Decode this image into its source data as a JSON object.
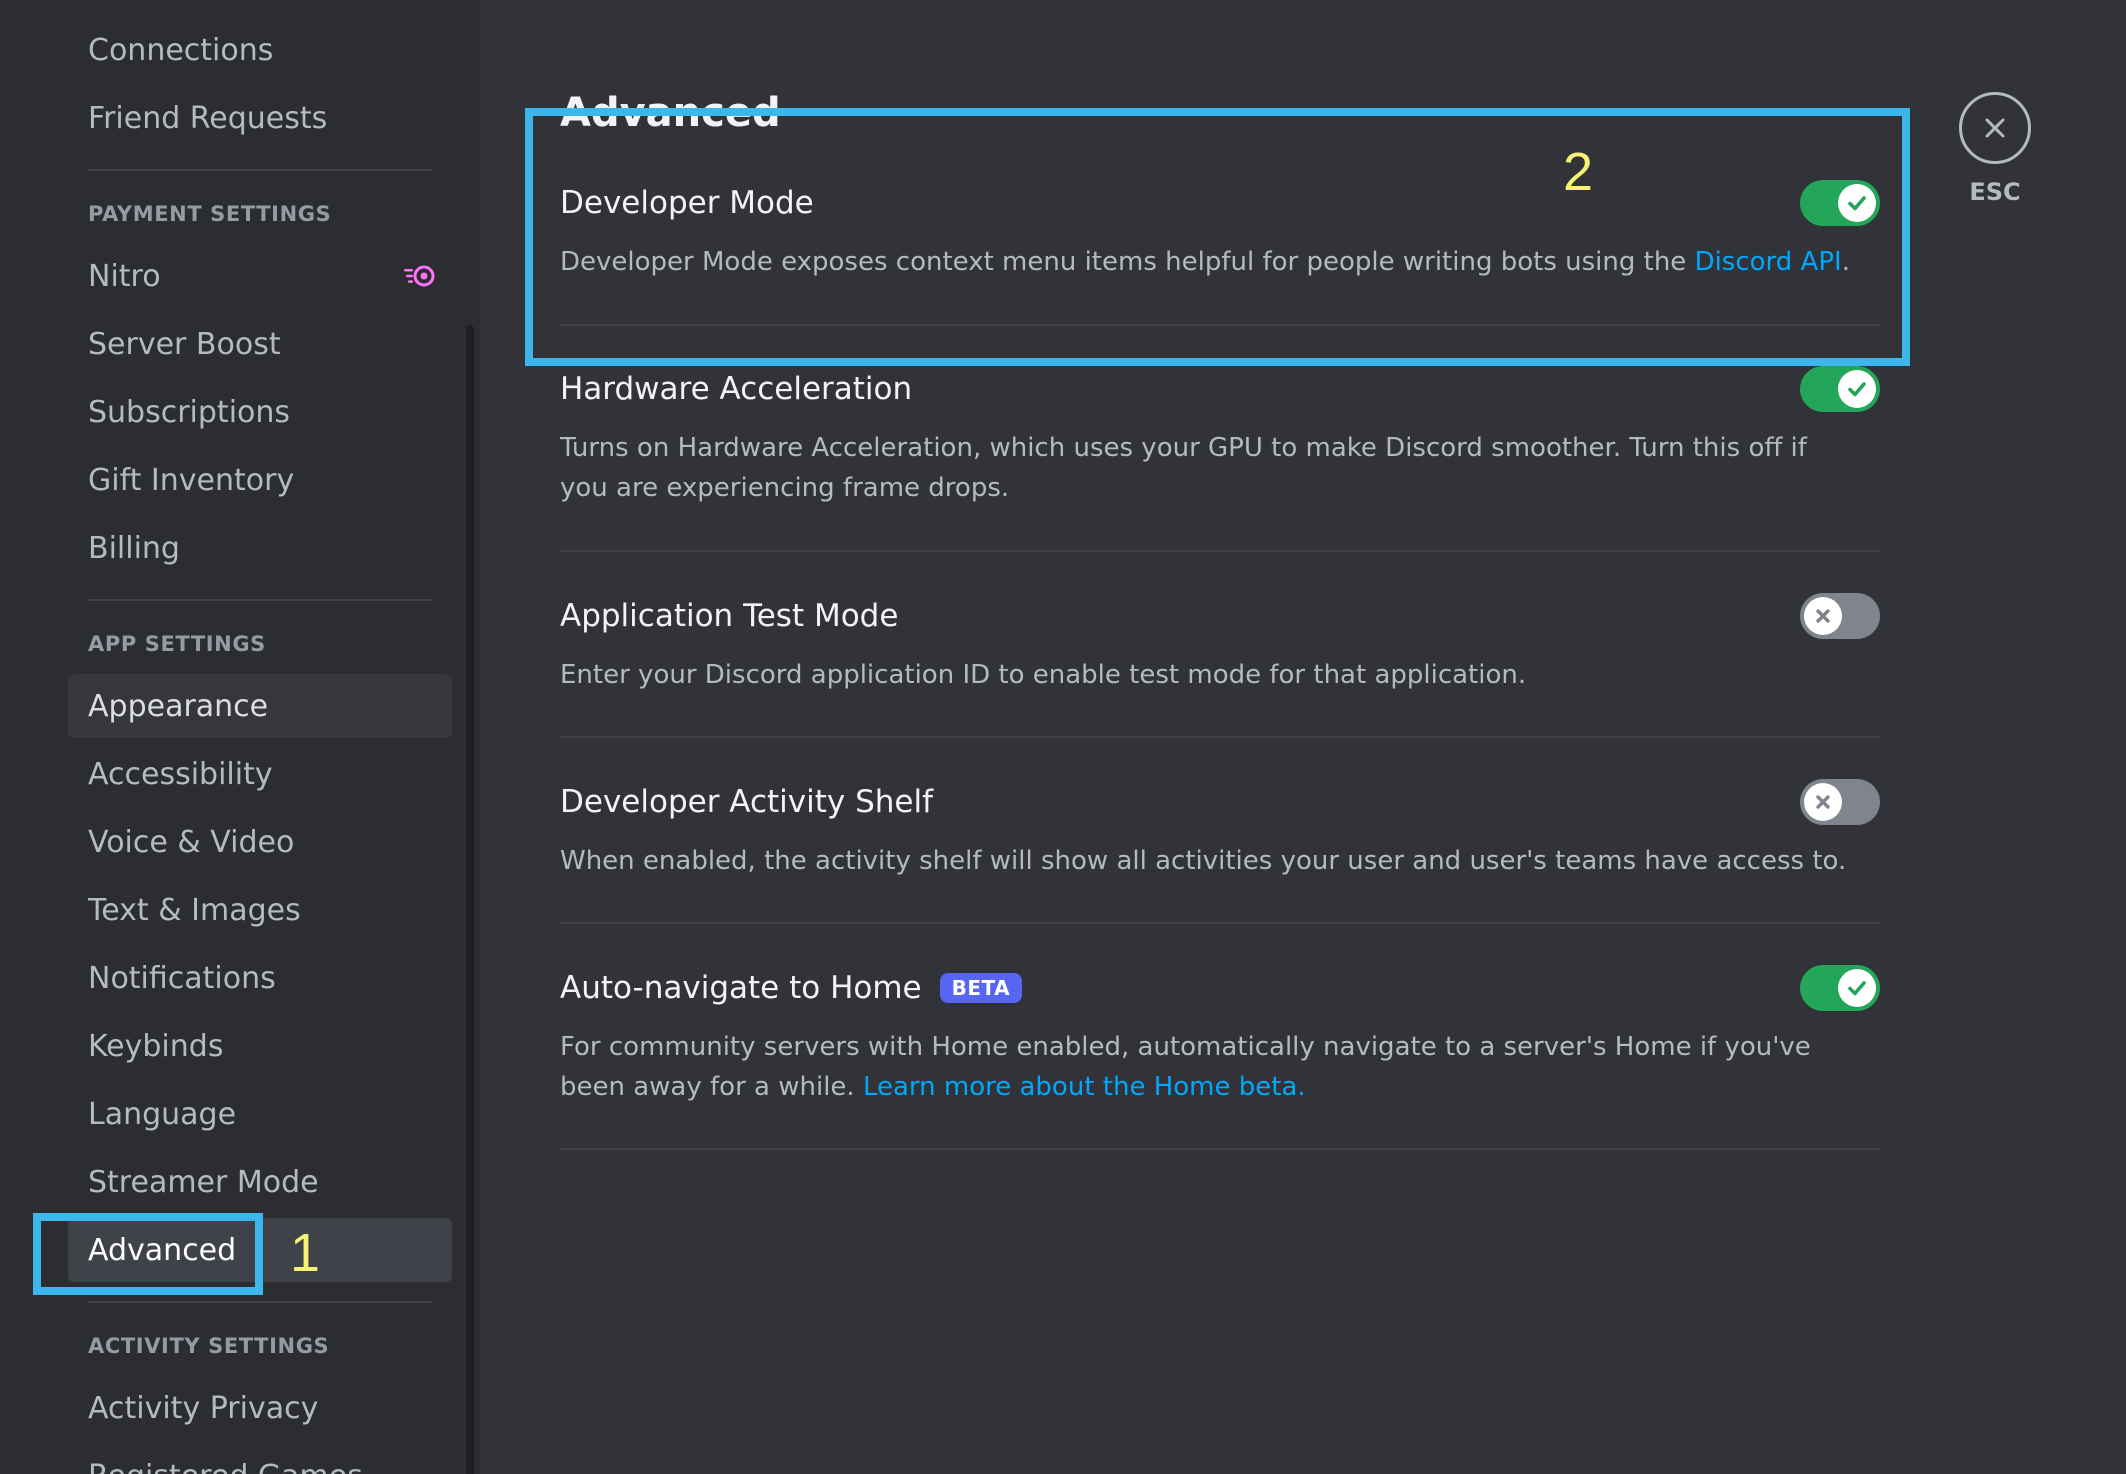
{
  "sidebar": {
    "top_items": [
      {
        "label": "Connections"
      },
      {
        "label": "Friend Requests"
      }
    ],
    "payment_settings": {
      "header": "PAYMENT SETTINGS",
      "items": [
        {
          "label": "Nitro"
        },
        {
          "label": "Server Boost"
        },
        {
          "label": "Subscriptions"
        },
        {
          "label": "Gift Inventory"
        },
        {
          "label": "Billing"
        }
      ]
    },
    "app_settings": {
      "header": "APP SETTINGS",
      "items": [
        {
          "label": "Appearance",
          "state": "hover"
        },
        {
          "label": "Accessibility"
        },
        {
          "label": "Voice & Video"
        },
        {
          "label": "Text & Images"
        },
        {
          "label": "Notifications"
        },
        {
          "label": "Keybinds"
        },
        {
          "label": "Language"
        },
        {
          "label": "Streamer Mode"
        },
        {
          "label": "Advanced",
          "state": "selected"
        }
      ]
    },
    "activity_settings": {
      "header": "ACTIVITY SETTINGS",
      "items": [
        {
          "label": "Activity Privacy"
        },
        {
          "label": "Registered Games"
        }
      ]
    }
  },
  "content": {
    "title": "Advanced",
    "settings": [
      {
        "title": "Developer Mode",
        "description": "Developer Mode exposes context menu items helpful for people writing bots using the ",
        "link": "Discord API",
        "description_after": ".",
        "enabled": true
      },
      {
        "title": "Hardware Acceleration",
        "description": "Turns on Hardware Acceleration, which uses your GPU to make Discord smoother. Turn this off if you are experiencing frame drops.",
        "enabled": true
      },
      {
        "title": "Application Test Mode",
        "description": "Enter your Discord application ID to enable test mode for that application.",
        "enabled": false
      },
      {
        "title": "Developer Activity Shelf",
        "description": "When enabled, the activity shelf will show all activities your user and user's teams have access to.",
        "enabled": false
      },
      {
        "title": "Auto-navigate to Home",
        "badge": "BETA",
        "description": "For community servers with Home enabled, automatically navigate to a server's Home if you've been away for a while. ",
        "link": "Learn more about the Home beta.",
        "enabled": true
      }
    ]
  },
  "close": {
    "label": "ESC"
  },
  "annotations": [
    {
      "label": "1"
    },
    {
      "label": "2"
    }
  ],
  "colors": {
    "toggle_on": "#23a55a",
    "toggle_off": "#80848e",
    "link": "#00a8fc",
    "beta_badge": "#5865f2",
    "annotation_box": "#3db6ec",
    "annotation_number": "#f7f272"
  },
  "icons": {
    "nitro": "nitro-icon",
    "toggle_on": "checkmark-icon",
    "toggle_off": "x-icon",
    "close": "close-icon"
  }
}
